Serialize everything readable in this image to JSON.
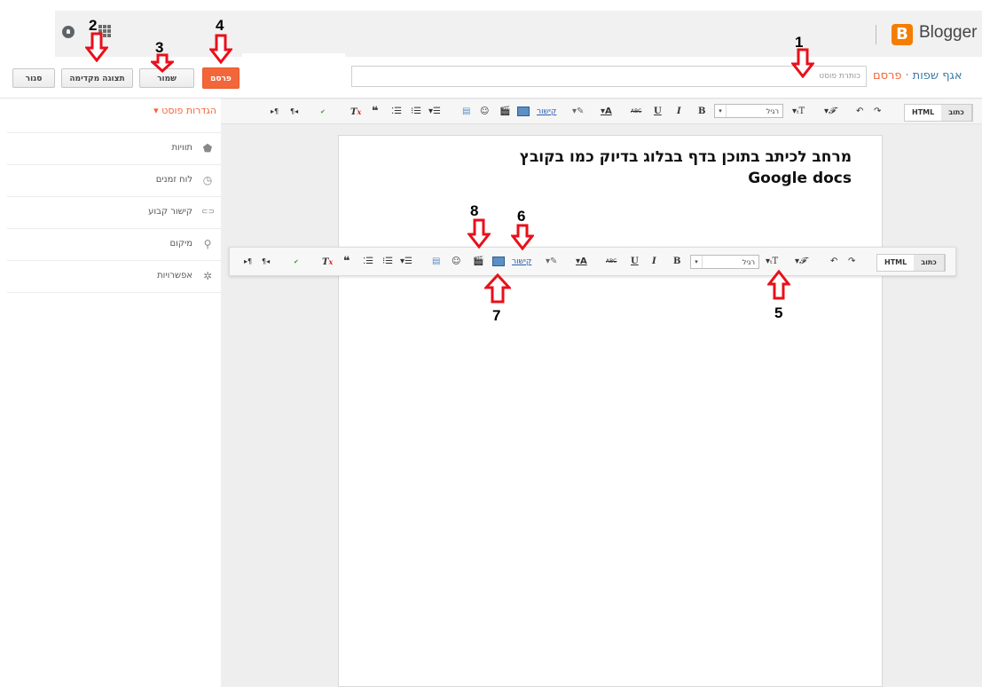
{
  "header": {
    "app_name": "Blogger",
    "logo_letter": "B"
  },
  "actions": {
    "close_label": "סגור",
    "preview_label": "תצוגה מקדימה",
    "save_label": "שמור",
    "publish_label": "פרסם"
  },
  "post": {
    "title_placeholder": "כותרת פוסט",
    "blog_name": "אגף שפות",
    "breadcrumb": "פרסם",
    "separator": "·",
    "content_line1": "מרחב לכיתב בתוכן בדף בבלוג בדיוק כמו בקובץ",
    "content_line2": "Google docs"
  },
  "sidebar": {
    "heading": "▾ הגדרות פוסט",
    "items": [
      {
        "label": "תוויות",
        "icon": "tag-icon",
        "glyph": "🏷"
      },
      {
        "label": "לוח זמנים",
        "icon": "clock-icon",
        "glyph": "◷"
      },
      {
        "label": "קישור קבוע",
        "icon": "link-chain-icon",
        "glyph": "⊂⊃"
      },
      {
        "label": "מיקום",
        "icon": "location-pin-icon",
        "glyph": "⚲"
      },
      {
        "label": "אפשרויות",
        "icon": "gear-icon",
        "glyph": "✲"
      }
    ]
  },
  "toolbar": {
    "compose_tab": "כתוב",
    "html_tab": "HTML",
    "format_value": "רגיל",
    "link_label": "קישור",
    "bold": "B",
    "italic": "I",
    "underline": "U",
    "strike": "ABC"
  },
  "annotations": {
    "n1": "1",
    "n2": "2",
    "n3": "3",
    "n4": "4",
    "n5": "5",
    "n6": "6",
    "n7": "7",
    "n8": "8"
  },
  "colors": {
    "accent": "#f2663a",
    "brand": "#f57d00",
    "link": "#3a7aa6",
    "arrow": "#e8101a"
  }
}
